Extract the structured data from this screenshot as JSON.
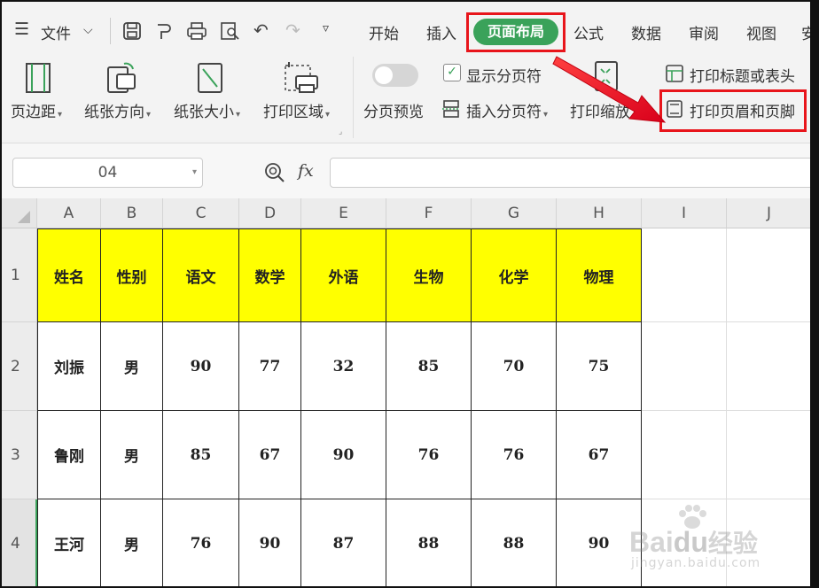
{
  "menu": {
    "file_label": "文件"
  },
  "tabs": [
    "开始",
    "插入",
    "页面布局",
    "公式",
    "数据",
    "审阅",
    "视图",
    "安"
  ],
  "ribbon": {
    "margins_label": "页边距",
    "orientation_label": "纸张方向",
    "size_label": "纸张大小",
    "print_area_label": "打印区域",
    "page_break_preview_label": "分页预览",
    "show_page_break_label": "显示分页符",
    "insert_page_break_label": "插入分页符",
    "print_scale_label": "打印缩放",
    "print_titles_label": "打印标题或表头",
    "print_header_footer_label": "打印页眉和页脚"
  },
  "formula": {
    "namebox": "04",
    "fx": "fx"
  },
  "columns": [
    "A",
    "B",
    "C",
    "D",
    "E",
    "F",
    "G",
    "H",
    "I",
    "J"
  ],
  "rows": [
    "1",
    "2",
    "3",
    "4"
  ],
  "table": {
    "headers": [
      "姓名",
      "性别",
      "语文",
      "数学",
      "外语",
      "生物",
      "化学",
      "物理"
    ],
    "data": [
      [
        "刘振",
        "男",
        "90",
        "77",
        "32",
        "85",
        "70",
        "75"
      ],
      [
        "鲁刚",
        "男",
        "85",
        "67",
        "90",
        "76",
        "76",
        "67"
      ],
      [
        "王河",
        "男",
        "76",
        "90",
        "87",
        "88",
        "88",
        "90"
      ]
    ]
  },
  "watermark": {
    "brand": "Bai",
    "brand2": "du",
    "brand3": "经验",
    "url": "jingyan.baidu.com"
  },
  "colors": {
    "accent": "#3aa25a",
    "highlight": "#e8151b",
    "header_fill": "#ffff00"
  }
}
